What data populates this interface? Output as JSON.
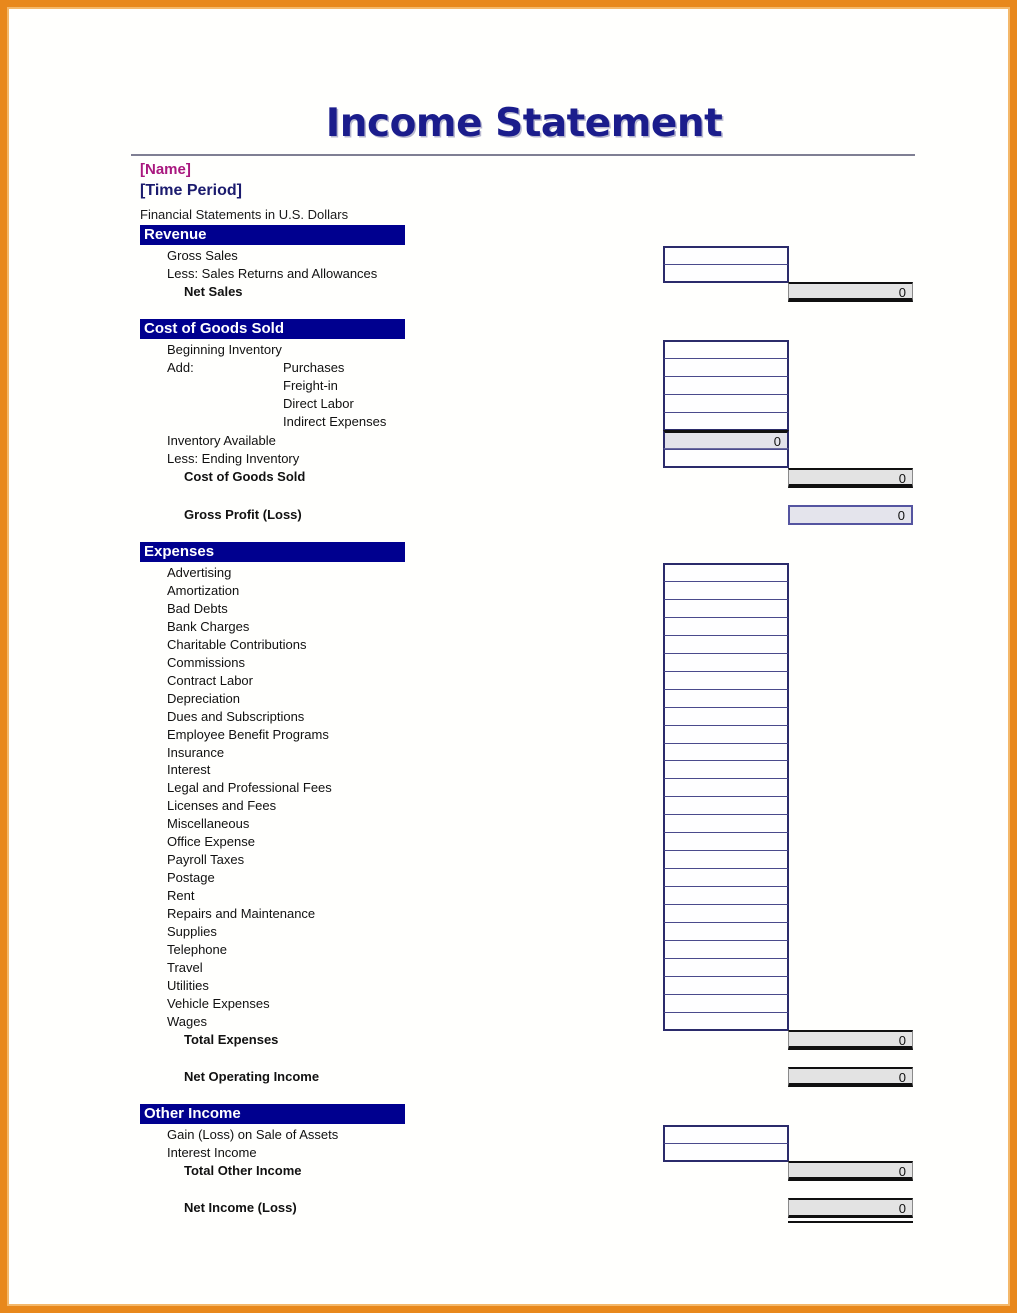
{
  "document": {
    "title": "Income Statement",
    "name_placeholder": "[Name]",
    "time_period_placeholder": "[Time Period]",
    "currency_note": "Financial Statements in U.S. Dollars",
    "frame_color": "#e8881c",
    "header_bar_color": "#00008f",
    "title_color": "#1b1d8c",
    "name_color": "#a9187f"
  },
  "sections": {
    "revenue": {
      "header": "Revenue",
      "rows": [
        {
          "label": "Gross Sales",
          "value": ""
        },
        {
          "label": "Less: Sales Returns and Allowances",
          "value": ""
        }
      ],
      "total": {
        "label": "Net Sales",
        "value": "0"
      }
    },
    "cogs": {
      "header": "Cost of Goods Sold",
      "rows": [
        {
          "label": "Beginning Inventory",
          "sublabel": "",
          "value": ""
        },
        {
          "label": "Add:",
          "sublabel": "Purchases",
          "value": ""
        },
        {
          "label": "",
          "sublabel": "Freight-in",
          "value": ""
        },
        {
          "label": "",
          "sublabel": "Direct Labor",
          "value": ""
        },
        {
          "label": "",
          "sublabel": "Indirect Expenses",
          "value": ""
        }
      ],
      "subtotal": {
        "label": "Inventory Available",
        "value": "0"
      },
      "ending_inventory": {
        "label": "Less: Ending Inventory",
        "value": ""
      },
      "total": {
        "label": "Cost of Goods Sold",
        "value": "0"
      }
    },
    "gross_profit": {
      "label": "Gross Profit (Loss)",
      "value": "0"
    },
    "expenses": {
      "header": "Expenses",
      "rows": [
        {
          "label": "Advertising",
          "value": ""
        },
        {
          "label": "Amortization",
          "value": ""
        },
        {
          "label": "Bad Debts",
          "value": ""
        },
        {
          "label": "Bank Charges",
          "value": ""
        },
        {
          "label": "Charitable Contributions",
          "value": ""
        },
        {
          "label": "Commissions",
          "value": ""
        },
        {
          "label": "Contract Labor",
          "value": ""
        },
        {
          "label": "Depreciation",
          "value": ""
        },
        {
          "label": "Dues and Subscriptions",
          "value": ""
        },
        {
          "label": "Employee Benefit Programs",
          "value": ""
        },
        {
          "label": "Insurance",
          "value": ""
        },
        {
          "label": "Interest",
          "value": ""
        },
        {
          "label": "Legal and Professional Fees",
          "value": ""
        },
        {
          "label": "Licenses and Fees",
          "value": ""
        },
        {
          "label": "Miscellaneous",
          "value": ""
        },
        {
          "label": "Office Expense",
          "value": ""
        },
        {
          "label": "Payroll Taxes",
          "value": ""
        },
        {
          "label": "Postage",
          "value": ""
        },
        {
          "label": "Rent",
          "value": ""
        },
        {
          "label": "Repairs and Maintenance",
          "value": ""
        },
        {
          "label": "Supplies",
          "value": ""
        },
        {
          "label": "Telephone",
          "value": ""
        },
        {
          "label": "Travel",
          "value": ""
        },
        {
          "label": "Utilities",
          "value": ""
        },
        {
          "label": "Vehicle Expenses",
          "value": ""
        },
        {
          "label": "Wages",
          "value": ""
        }
      ],
      "total": {
        "label": "Total Expenses",
        "value": "0"
      }
    },
    "net_operating_income": {
      "label": "Net Operating Income",
      "value": "0"
    },
    "other_income": {
      "header": "Other Income",
      "rows": [
        {
          "label": "Gain (Loss) on Sale of Assets",
          "value": ""
        },
        {
          "label": "Interest Income",
          "value": ""
        }
      ],
      "total": {
        "label": "Total Other Income",
        "value": "0"
      }
    },
    "net_income": {
      "label": "Net Income (Loss)",
      "value": "0"
    }
  }
}
